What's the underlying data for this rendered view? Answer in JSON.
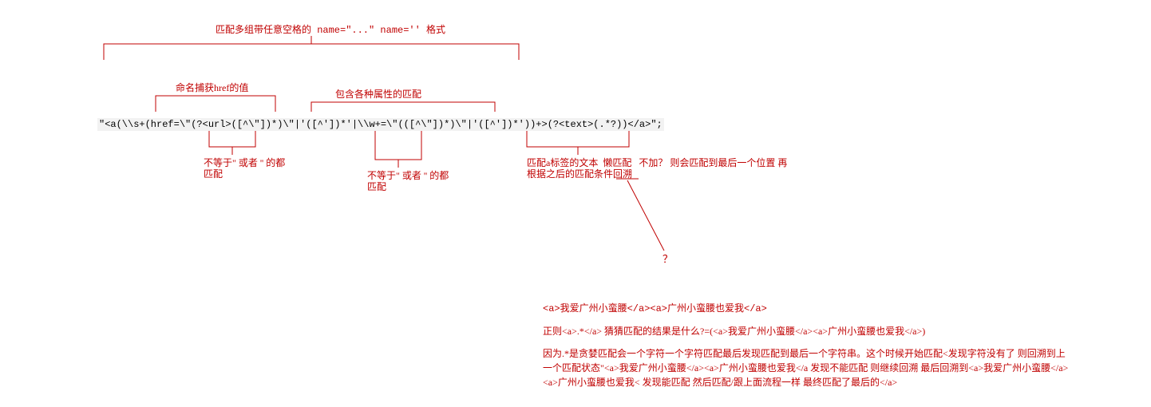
{
  "labels": {
    "top": "匹配多组带任意空格的 name=\"...\" name='' 格式",
    "named_capture": "命名捕获href的值",
    "attrs": "包含各种属性的匹配",
    "neq1_line1": "不等于\" 或者 '' 的都",
    "neq1_line2": "匹配",
    "neq2_line1": "不等于\" 或者 '' 的都",
    "neq2_line2": "匹配",
    "lazy_line1": "匹配a标签的文本  懒匹配   不加？ 则会匹配到最后一个位置 再",
    "lazy_line2": "根据之后的匹配条件回溯",
    "qmark": "？"
  },
  "regex": "\"<a(\\\\s+(href=\\\"(?<url>([^\\\"])*)\\\"|'([^'])*'|\\\\w+=\\\"(([^\\\"])*)\\\"|'([^'])*'))+>(?<text>(.*?))</a>\";",
  "explain": {
    "sample": "<a>我爱广州小蛮腰</a><a>广州小蛮腰也爱我</a>",
    "p1": "正则<a>.*</a>  猜猜匹配的结果是什么?=(<a>我爱广州小蛮腰</a><a>广州小蛮腰也爱我</a>)",
    "p2": "因为.*是贪婪匹配会一个字符一个字符匹配最后发现匹配到最后一个字符串。这个时候开始匹配<发现字符没有了 则回溯到上一个匹配状态\"<a>我爱广州小蛮腰</a><a>广州小蛮腰也爱我</a  发现不能匹配 则继续回溯 最后回溯到<a>我爱广州小蛮腰</a><a>广州小蛮腰也爱我< 发现能匹配 然后匹配/跟上面流程一样 最终匹配了最后的</a>"
  }
}
